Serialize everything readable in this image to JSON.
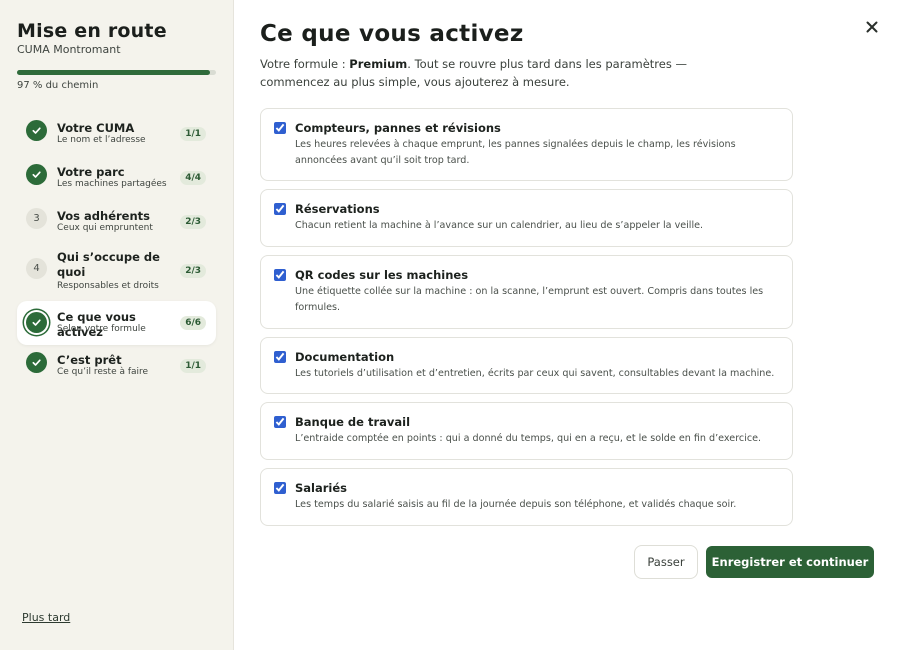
{
  "sidebar": {
    "title": "Mise en route",
    "subtitle": "CUMA Montromant",
    "progress": {
      "percent": 97,
      "label": "97 % du chemin"
    },
    "steps": [
      {
        "badge": "",
        "status": "done",
        "title": "Votre CUMA",
        "desc": "Le nom et l’adresse",
        "count": "1/1"
      },
      {
        "badge": "",
        "status": "done",
        "title": "Votre parc",
        "desc": "Les machines partagées",
        "count": "4/4"
      },
      {
        "badge": "3",
        "status": "todo",
        "title": "Vos adhérents",
        "desc": "Ceux qui empruntent",
        "count": "2/3"
      },
      {
        "badge": "4",
        "status": "todo",
        "title": "Qui s’occupe de quoi",
        "desc": "Responsables et droits",
        "count": "2/3"
      },
      {
        "badge": "",
        "status": "current",
        "title": "Ce que vous activez",
        "desc": "Selon votre formule",
        "count": "6/6"
      },
      {
        "badge": "",
        "status": "done",
        "title": "C’est prêt",
        "desc": "Ce qu’il reste à faire",
        "count": "1/1"
      }
    ],
    "later_link": "Plus tard"
  },
  "main": {
    "title": "Ce que vous activez",
    "intro_prefix": "Votre formule : ",
    "intro_plan": "Premium",
    "intro_suffix": ". Tout se rouvre plus tard dans les paramètres — commencez au plus simple, vous ajouterez à mesure.",
    "options": [
      {
        "title": "Compteurs, pannes et révisions",
        "desc": "Les heures relevées à chaque emprunt, les pannes signalées depuis le champ, les révisions annoncées avant qu’il soit trop tard.",
        "checked": true
      },
      {
        "title": "Réservations",
        "desc": "Chacun retient la machine à l’avance sur un calendrier, au lieu de s’appeler la veille.",
        "checked": true
      },
      {
        "title": "QR codes sur les machines",
        "desc": "Une étiquette collée sur la machine : on la scanne, l’emprunt est ouvert. Compris dans toutes les formules.",
        "checked": true
      },
      {
        "title": "Documentation",
        "desc": "Les tutoriels d’utilisation et d’entretien, écrits par ceux qui savent, consultables devant la machine.",
        "checked": true
      },
      {
        "title": "Banque de travail",
        "desc": "L’entraide comptée en points : qui a donné du temps, qui en a reçu, et le solde en fin d’exercice.",
        "checked": true
      },
      {
        "title": "Salariés",
        "desc": "Les temps du salarié saisis au fil de la journée depuis son téléphone, et validés chaque soir.",
        "checked": true
      }
    ],
    "skip_label": "Passer",
    "save_label": "Enregistrer et continuer"
  },
  "icons": {
    "close": "close-icon",
    "check": "check-icon"
  },
  "colors": {
    "accent": "#2c6136",
    "sidebar_bg": "#f4f3ec",
    "checkbox": "#2f5fd0"
  }
}
